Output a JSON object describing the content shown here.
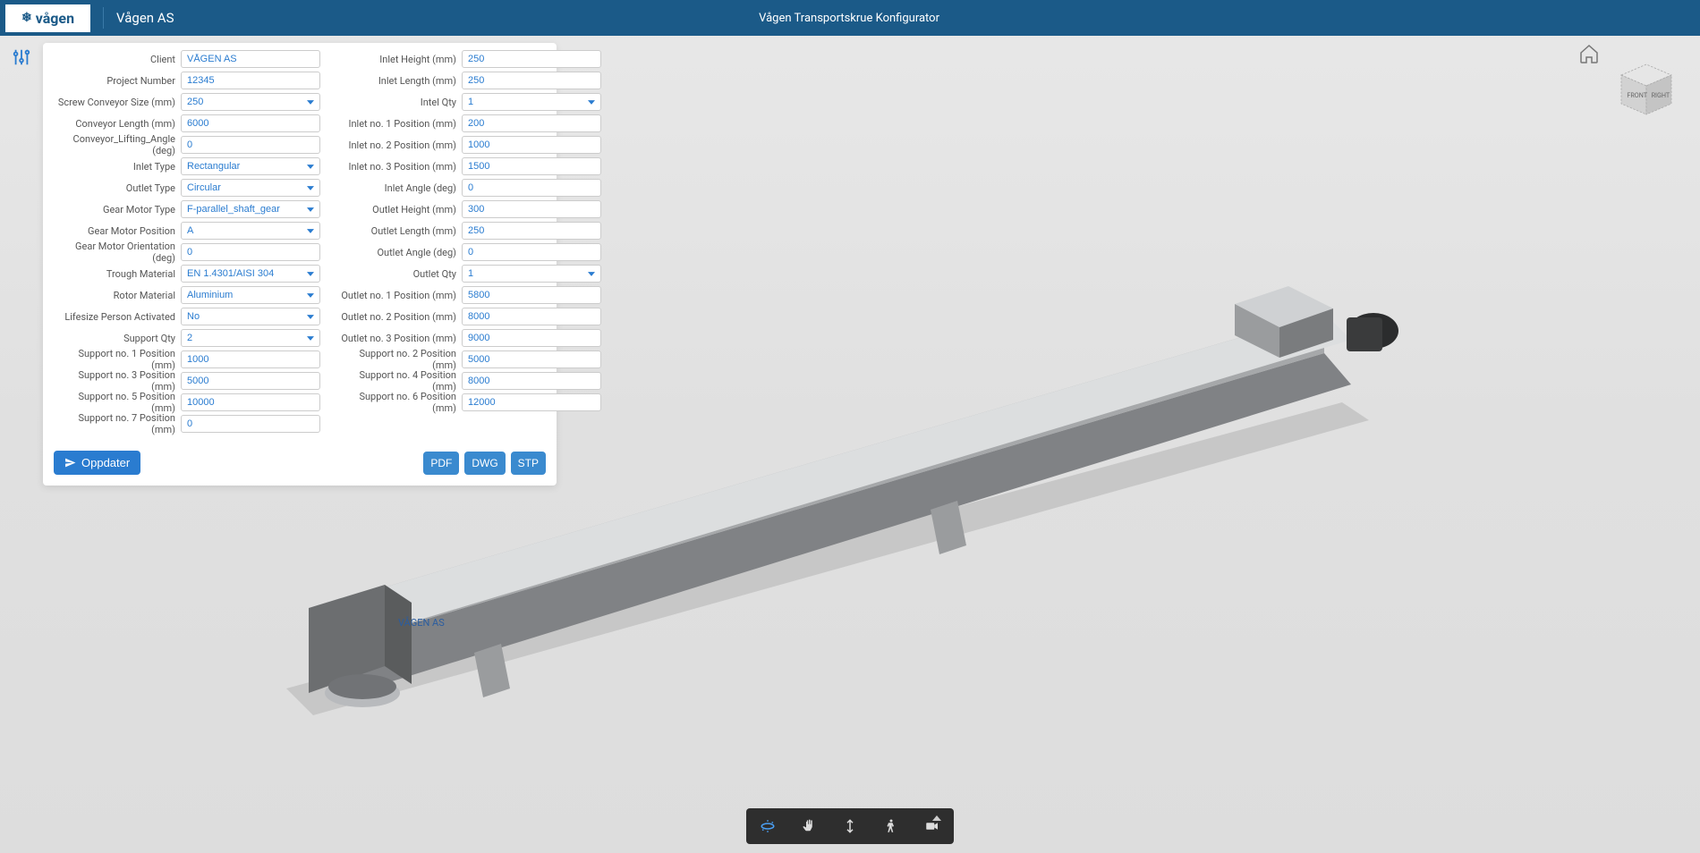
{
  "header": {
    "logo_text": "vågen",
    "company": "Vågen AS",
    "product": "Vågen Transportskrue Konfigurator"
  },
  "form": {
    "left": [
      {
        "label": "Client",
        "type": "text",
        "value": "VÅGEN AS",
        "name": "client-field"
      },
      {
        "label": "Project Number",
        "type": "text",
        "value": "12345",
        "name": "project-number-field"
      },
      {
        "label": "Screw Conveyor Size (mm)",
        "type": "select",
        "value": "250",
        "name": "screw-conveyor-size-select"
      },
      {
        "label": "Conveyor Length (mm)",
        "type": "text",
        "value": "6000",
        "name": "conveyor-length-field"
      },
      {
        "label": "Conveyor_Lifting_Angle (deg)",
        "type": "text",
        "value": "0",
        "name": "conveyor-lifting-angle-field"
      },
      {
        "label": "Inlet Type",
        "type": "select",
        "value": "Rectangular",
        "name": "inlet-type-select"
      },
      {
        "label": "Outlet Type",
        "type": "select",
        "value": "Circular",
        "name": "outlet-type-select"
      },
      {
        "label": "Gear Motor Type",
        "type": "select",
        "value": "F-parallel_shaft_gear",
        "name": "gear-motor-type-select"
      },
      {
        "label": "Gear Motor Position",
        "type": "select",
        "value": "A",
        "name": "gear-motor-position-select"
      },
      {
        "label": "Gear Motor Orientation (deg)",
        "type": "text",
        "value": "0",
        "name": "gear-motor-orientation-field"
      },
      {
        "label": "Trough Material",
        "type": "select",
        "value": "EN 1.4301/AISI 304",
        "name": "trough-material-select"
      },
      {
        "label": "Rotor Material",
        "type": "select",
        "value": "Aluminium",
        "name": "rotor-material-select"
      },
      {
        "label": "Lifesize Person Activated",
        "type": "select",
        "value": "No",
        "name": "lifesize-person-select"
      },
      {
        "label": "Support Qty",
        "type": "select",
        "value": "2",
        "name": "support-qty-select"
      },
      {
        "label": "Support no. 1 Position (mm)",
        "type": "text",
        "value": "1000",
        "name": "support-1-position-field"
      },
      {
        "label": "Support no. 3 Position (mm)",
        "type": "text",
        "value": "5000",
        "name": "support-3-position-field"
      },
      {
        "label": "Support no. 5 Position (mm)",
        "type": "text",
        "value": "10000",
        "name": "support-5-position-field"
      },
      {
        "label": "Support no. 7 Position (mm)",
        "type": "text",
        "value": "0",
        "name": "support-7-position-field"
      }
    ],
    "right": [
      {
        "label": "Inlet Height (mm)",
        "type": "text",
        "value": "250",
        "name": "inlet-height-field"
      },
      {
        "label": "Inlet Length (mm)",
        "type": "text",
        "value": "250",
        "name": "inlet-length-field"
      },
      {
        "label": "Intel Qty",
        "type": "select",
        "value": "1",
        "name": "inlet-qty-select"
      },
      {
        "label": "Inlet no. 1 Position (mm)",
        "type": "text",
        "value": "200",
        "name": "inlet-1-position-field"
      },
      {
        "label": "Inlet no. 2 Position (mm)",
        "type": "text",
        "value": "1000",
        "name": "inlet-2-position-field"
      },
      {
        "label": "Inlet no. 3 Position (mm)",
        "type": "text",
        "value": "1500",
        "name": "inlet-3-position-field"
      },
      {
        "label": "Inlet Angle (deg)",
        "type": "text",
        "value": "0",
        "name": "inlet-angle-field"
      },
      {
        "label": "Outlet Height (mm)",
        "type": "text",
        "value": "300",
        "name": "outlet-height-field"
      },
      {
        "label": "Outlet Length (mm)",
        "type": "text",
        "value": "250",
        "name": "outlet-length-field"
      },
      {
        "label": "Outlet Angle (deg)",
        "type": "text",
        "value": "0",
        "name": "outlet-angle-field"
      },
      {
        "label": "Outlet Qty",
        "type": "select",
        "value": "1",
        "name": "outlet-qty-select"
      },
      {
        "label": "Outlet no. 1 Position (mm)",
        "type": "text",
        "value": "5800",
        "name": "outlet-1-position-field"
      },
      {
        "label": "Outlet no. 2 Position (mm)",
        "type": "text",
        "value": "8000",
        "name": "outlet-2-position-field"
      },
      {
        "label": "Outlet no. 3 Position (mm)",
        "type": "text",
        "value": "9000",
        "name": "outlet-3-position-field"
      },
      {
        "label": "Support no. 2 Position (mm)",
        "type": "text",
        "value": "5000",
        "name": "support-2-position-field"
      },
      {
        "label": "Support no. 4 Position (mm)",
        "type": "text",
        "value": "8000",
        "name": "support-4-position-field"
      },
      {
        "label": "Support no. 6 Position (mm)",
        "type": "text",
        "value": "12000",
        "name": "support-6-position-field"
      }
    ]
  },
  "buttons": {
    "update": "Oppdater",
    "pdf": "PDF",
    "dwg": "DWG",
    "stp": "STP"
  },
  "viewcube": {
    "face_front": "FRONT",
    "face_right": "RIGHT"
  },
  "render_label": "VÅGEN AS"
}
